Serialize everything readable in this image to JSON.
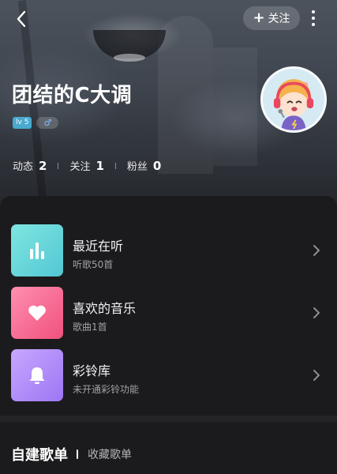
{
  "header": {
    "follow_label": "关注",
    "follow_icon": "+",
    "username": "团结的C大调",
    "level_badge": "lv 5",
    "gender_symbol": "♂",
    "stats": [
      {
        "label": "动态",
        "value": "2"
      },
      {
        "label": "关注",
        "value": "1"
      },
      {
        "label": "粉丝",
        "value": "0"
      }
    ]
  },
  "library": [
    {
      "title": "最近在听",
      "subtitle": "听歌50首",
      "icon": "bar-chart-icon"
    },
    {
      "title": "喜欢的音乐",
      "subtitle": "歌曲1首",
      "icon": "heart-icon"
    },
    {
      "title": "彩铃库",
      "subtitle": "未开通彩铃功能",
      "icon": "bell-icon"
    }
  ],
  "playlists": {
    "tab_created": "自建歌单",
    "tab_favorited": "收藏歌单"
  },
  "colors": {
    "recent": "#52c7d3",
    "liked": "#f0517d",
    "ringtone": "#9d76f3",
    "background": "#1b1b1d"
  }
}
